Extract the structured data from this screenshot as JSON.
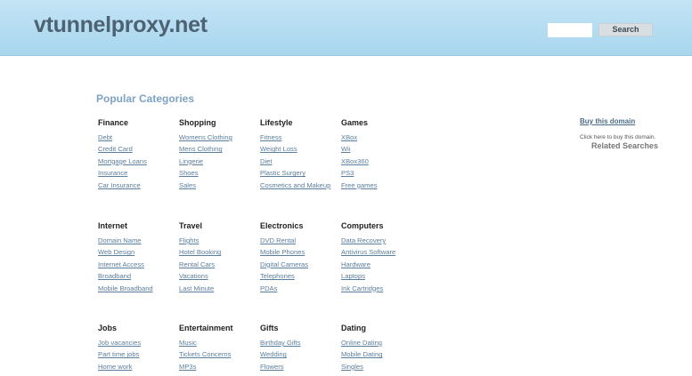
{
  "header": {
    "site_title": "vtunnelproxy.net",
    "search_placeholder": "",
    "search_button": "Search"
  },
  "main": {
    "section_title": "Popular Categories",
    "categories": [
      {
        "name": "Finance",
        "links": [
          "Debt",
          "Credit Card",
          "Mortgage Loans",
          "Insurance",
          "Car Insurance"
        ]
      },
      {
        "name": "Shopping",
        "links": [
          "Womens Clothing",
          "Mens Clothing",
          "Lingerie",
          "Shoes",
          "Sales"
        ]
      },
      {
        "name": "Lifestyle",
        "links": [
          "Fitness",
          "Weight Loss",
          "Diet",
          "Plastic Surgery",
          "Cosmetics and Makeup"
        ]
      },
      {
        "name": "Games",
        "links": [
          "XBox",
          "Wii",
          "XBox360",
          "PS3",
          "Free games"
        ]
      },
      {
        "name": "Internet",
        "links": [
          "Domain Name",
          "Web Design",
          "Internet Access",
          "Broadband",
          "Mobile Broadband"
        ]
      },
      {
        "name": "Travel",
        "links": [
          "Flights",
          "Hotel Booking",
          "Rental Cars",
          "Vacations",
          "Last Minute"
        ]
      },
      {
        "name": "Electronics",
        "links": [
          "DVD Rental",
          "Mobile Phones",
          "Digital Cameras",
          "Telephones",
          "PDAs"
        ]
      },
      {
        "name": "Computers",
        "links": [
          "Data Recovery",
          "Antivirus Software",
          "Hardware",
          "Laptops",
          "Ink Cartridges"
        ]
      },
      {
        "name": "Jobs",
        "links": [
          "Job vacancies",
          "Part time jobs",
          "Home work"
        ]
      },
      {
        "name": "Entertainment",
        "links": [
          "Music",
          "Tickets Concerns",
          "MP3s"
        ]
      },
      {
        "name": "Gifts",
        "links": [
          "Birthday Gifts",
          "Wedding",
          "Flowers"
        ]
      },
      {
        "name": "Dating",
        "links": [
          "Online Dating",
          "Mobile Dating",
          "Singles"
        ]
      }
    ]
  },
  "sidebar": {
    "buy_link": "Buy this domain",
    "buy_text": "Click here to buy this domain.",
    "related_heading": "Related Searches"
  },
  "colors": {
    "header_bg": "#b4dcf1",
    "title": "#4d6272",
    "section_title": "#7da3c4",
    "link": "#5b7e9d"
  }
}
